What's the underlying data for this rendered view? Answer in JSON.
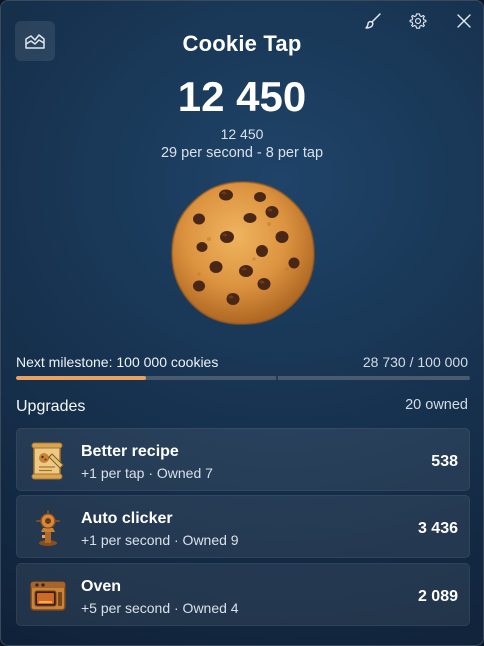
{
  "app": {
    "title": "Cookie Tap",
    "icons": [
      "stats-chart-icon",
      "paintbrush-icon",
      "gear-icon",
      "close-icon"
    ]
  },
  "counter": {
    "count": "12 450",
    "count_small": "12 450",
    "rate": "29 per second - 8 per tap"
  },
  "milestone": {
    "label": "Next milestone: 100 000 cookies",
    "value": "28 730 / 100 000",
    "progress": 0.2873
  },
  "upgrades": {
    "title": "Upgrades",
    "owned": "20 owned",
    "items": [
      {
        "name": "Better recipe",
        "desc": "+1 per tap · Owned 7",
        "price": "538",
        "icon": "recipe-scroll-icon"
      },
      {
        "name": "Auto clicker",
        "desc": "+1 per second · Owned 9",
        "price": "3 436",
        "icon": "auto-clicker-icon"
      },
      {
        "name": "Oven",
        "desc": "+5 per second · Owned 4",
        "price": "2 089",
        "icon": "oven-icon"
      }
    ]
  },
  "colors": {
    "accent": "#e8a15e",
    "background": "#17324f"
  }
}
